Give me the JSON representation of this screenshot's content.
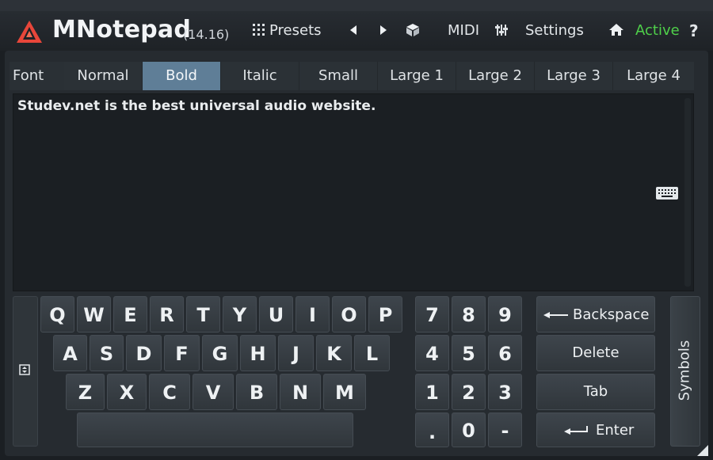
{
  "header": {
    "app_name": "MNotepad",
    "version": "(14.16)",
    "presets_label": "Presets",
    "midi_label": "MIDI",
    "settings_label": "Settings",
    "active_label": "Active",
    "help_label": "?",
    "logo_icon": "m-logo-icon",
    "accent_color": "#4fd04a"
  },
  "font_bar": {
    "label": "Font",
    "options": [
      "Normal",
      "Bold",
      "Italic",
      "Small",
      "Large 1",
      "Large 2",
      "Large 3",
      "Large 4"
    ],
    "selected": "Bold"
  },
  "editor": {
    "text": "Studev.net is the best universal audio website."
  },
  "keyboard": {
    "row1": [
      "Q",
      "W",
      "E",
      "R",
      "T",
      "Y",
      "U",
      "I",
      "O",
      "P"
    ],
    "row2": [
      "A",
      "S",
      "D",
      "F",
      "G",
      "H",
      "J",
      "K",
      "L"
    ],
    "row3": [
      "Z",
      "X",
      "C",
      "V",
      "B",
      "N",
      "M"
    ],
    "numpad": [
      "7",
      "8",
      "9",
      "4",
      "5",
      "6",
      "1",
      "2",
      "3",
      ".",
      "0",
      "-"
    ],
    "backspace_label": "Backspace",
    "delete_label": "Delete",
    "tab_label": "Tab",
    "enter_label": "Enter",
    "symbols_label": "Symbols"
  }
}
